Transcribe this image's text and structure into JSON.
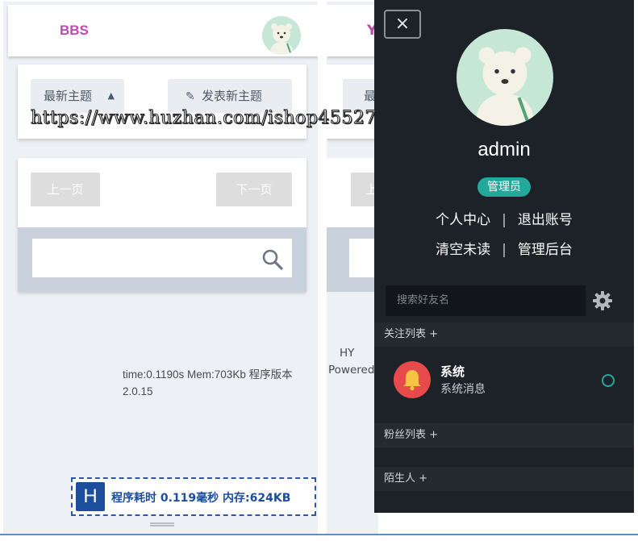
{
  "left_panel": {
    "brand": "BBS",
    "topic_select": "最新主题",
    "new_post_button": "发表新主题",
    "prev_page_button": "上一页",
    "next_page_button": "下一页",
    "runtime_text": "time:0.1190s Mem:703Kb 程序版本 2.0.15",
    "stat_logo": "H",
    "stat_text": "程序耗时 0.119毫秒 内存:624KB"
  },
  "middle_panel": {
    "brand_fragment": "Y",
    "select_fragment": "最",
    "page_fragment": "上",
    "footer_line1": "HY",
    "footer_line2": "Powered"
  },
  "drawer": {
    "close_label": "×",
    "username": "admin",
    "role_badge": "管理员",
    "links_row1": [
      "个人中心",
      "退出账号"
    ],
    "links_row2": [
      "清空未读",
      "管理后台"
    ],
    "search_placeholder": "搜索好友名",
    "sections": {
      "follow": "关注列表 +",
      "fans": "粉丝列表 +",
      "strangers": "陌生人 +"
    },
    "contact": {
      "name": "系统",
      "message": "系统消息"
    }
  },
  "watermark": "https://www.huzhan.com/ishop45527",
  "colors": {
    "brand": "#c048b0",
    "accent_teal": "#23a99b",
    "drawer_bg": "#1d2229",
    "stat_blue": "#1d4e9e",
    "bell_red": "#e64a4a"
  },
  "icons": [
    "bear-avatar-icon",
    "sort-arrows-icon",
    "edit-icon",
    "search-icon",
    "close-icon",
    "gear-icon",
    "bell-icon",
    "status-circle-icon",
    "drag-handle-icon"
  ]
}
